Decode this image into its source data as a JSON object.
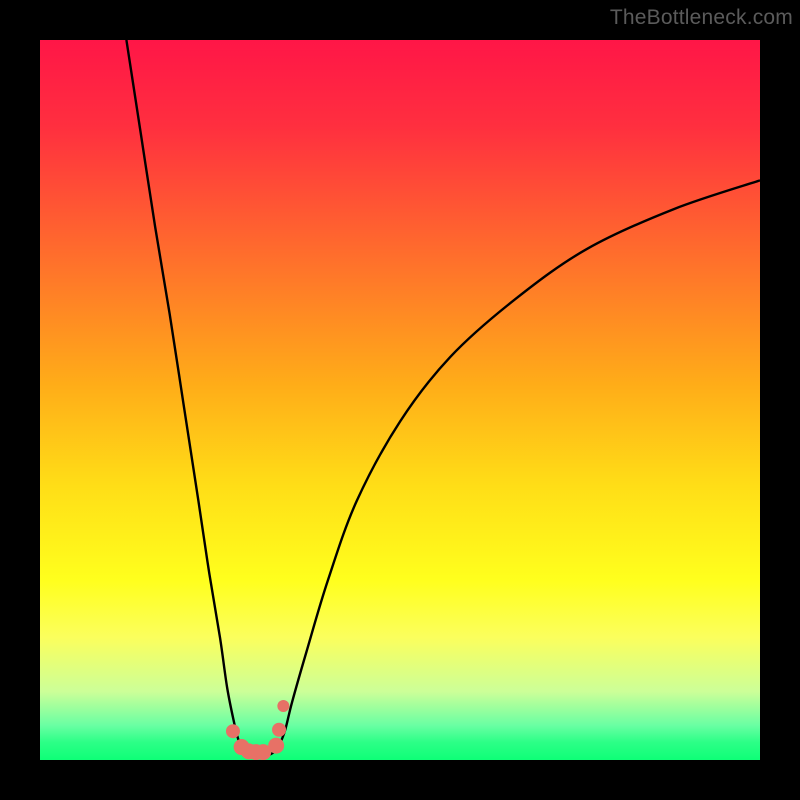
{
  "watermark": {
    "text": "TheBottleneck.com"
  },
  "colors": {
    "black": "#000000",
    "curve": "#000000",
    "marker": "#e77166",
    "gradientStops": [
      {
        "offset": 0.0,
        "color": "#ff1647"
      },
      {
        "offset": 0.12,
        "color": "#ff2f3f"
      },
      {
        "offset": 0.3,
        "color": "#ff6e2c"
      },
      {
        "offset": 0.48,
        "color": "#ffad18"
      },
      {
        "offset": 0.62,
        "color": "#ffde17"
      },
      {
        "offset": 0.75,
        "color": "#ffff1d"
      },
      {
        "offset": 0.83,
        "color": "#fbff5d"
      },
      {
        "offset": 0.905,
        "color": "#ccff98"
      },
      {
        "offset": 0.952,
        "color": "#69ffa3"
      },
      {
        "offset": 0.975,
        "color": "#2dff87"
      },
      {
        "offset": 1.0,
        "color": "#0eff77"
      }
    ]
  },
  "chart_data": {
    "type": "line",
    "title": "",
    "xlabel": "",
    "ylabel": "",
    "xlim": [
      0,
      100
    ],
    "ylim": [
      0,
      100
    ],
    "left_curve": {
      "name": "left-branch",
      "x": [
        12,
        14,
        16,
        18,
        20,
        22,
        23.5,
        25,
        26,
        27,
        27.5,
        28
      ],
      "y": [
        100,
        87,
        74,
        62,
        49,
        36,
        26,
        17,
        10,
        5,
        3,
        1.5
      ]
    },
    "right_curve": {
      "name": "right-branch",
      "x": [
        33,
        34,
        35,
        37,
        40,
        44,
        50,
        57,
        66,
        76,
        88,
        100
      ],
      "y": [
        1.5,
        4,
        8,
        15,
        25,
        36,
        47,
        56,
        64,
        71,
        76.5,
        80.5
      ]
    },
    "valley": {
      "name": "valley-floor",
      "x": [
        28,
        29,
        30,
        31,
        32,
        33
      ],
      "y": [
        1.5,
        0.8,
        0.6,
        0.6,
        0.8,
        1.5
      ]
    },
    "markers": {
      "name": "valley-markers",
      "x": [
        26.8,
        28.0,
        29.0,
        30.0,
        31.0,
        32.8,
        33.2,
        33.8
      ],
      "y": [
        4.0,
        1.8,
        1.2,
        1.1,
        1.1,
        2.0,
        4.2,
        7.5
      ],
      "r": [
        7,
        8,
        8,
        8,
        8,
        8,
        7,
        6
      ]
    }
  }
}
